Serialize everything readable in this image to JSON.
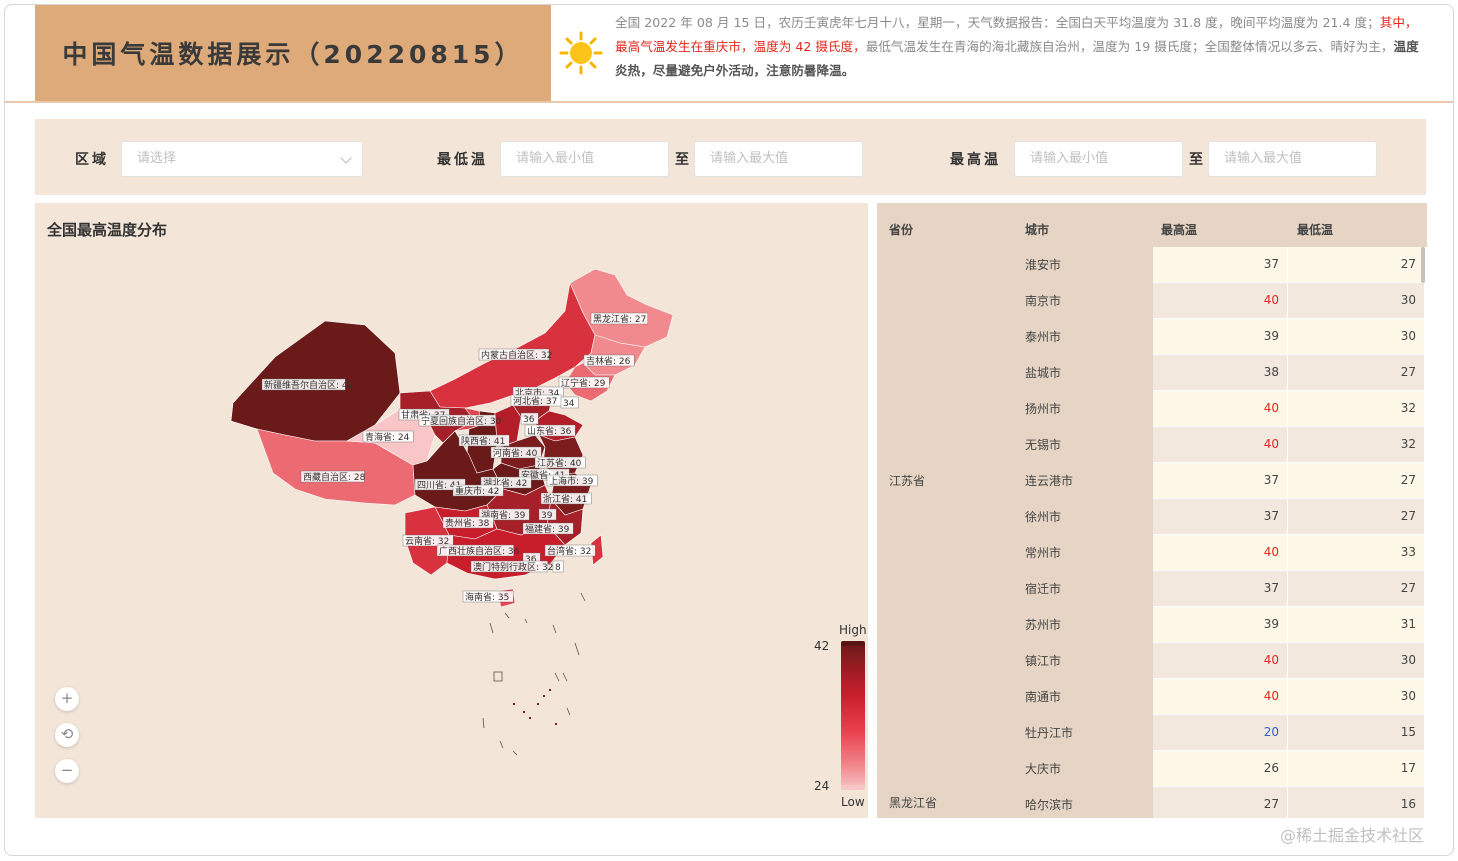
{
  "header": {
    "title": "中国气温数据展示（20220815）",
    "report_part1": "全国 2022 年 08 月 15 日，农历壬寅虎年七月十八，星期一，天气数据报告：全国白天平均温度为 31.8 度，晚间平均温度为 21.4 度；",
    "report_part2": "其中，最高气温发生在重庆市，温度为 42 摄氏度，",
    "report_part3": "最低气温发生在青海的海北藏族自治州，温度为 19 摄氏度；全国整体情况以多云、晴好为主，",
    "report_part4": "温度炎热，尽量避免户外活动，注意防暑降温。"
  },
  "filters": {
    "region_label": "区域",
    "region_placeholder": "请选择",
    "min_label": "最低温",
    "min_from_placeholder": "请输入最小值",
    "to_label": "至",
    "min_to_placeholder": "请输入最大值",
    "max_label": "最高温",
    "max_from_placeholder": "请输入最小值",
    "max_to_placeholder": "请输入最大值"
  },
  "map": {
    "title": "全国最高温度分布",
    "visual_map": {
      "high_label": "High",
      "low_label": "Low",
      "max": "42",
      "min": "24"
    },
    "zoom_in": "+",
    "zoom_reset": "⟲",
    "zoom_out": "−",
    "labels": [
      "黑龙江省: 27",
      "内蒙古自治区: 32",
      "吉林省: 26",
      "新疆维吾尔自治区: 41",
      "辽宁省: 29",
      "北京市: 34",
      "河北省: 37",
      "34",
      "甘肃省: 37",
      "宁夏回族自治区: 30",
      "36",
      "山东省: 36",
      "青海省: 24",
      "陕西省: 41",
      "河南省: 40",
      "江苏省: 40",
      "西藏自治区: 28",
      "安徽省: 41",
      "四川省: 41",
      "湖北省: 42",
      "重庆市: 42",
      "上海市: 39",
      "浙江省: 41",
      "湖南省: 39",
      "39",
      "贵州省: 38",
      "福建省: 39",
      "云南省: 32",
      "广西壮族自治区: 36",
      "36",
      "台湾省: 32",
      "澳门特别行政区: 32",
      "8",
      "海南省: 35"
    ]
  },
  "table": {
    "headers": [
      "省份",
      "城市",
      "最高温",
      "最低温"
    ],
    "province_groups": [
      {
        "name": "江苏省"
      },
      {
        "name": "黑龙江省"
      }
    ],
    "rows": [
      {
        "city": "淮安市",
        "max": "37",
        "min": "27",
        "flag": ""
      },
      {
        "city": "南京市",
        "max": "40",
        "min": "30",
        "flag": "hot"
      },
      {
        "city": "泰州市",
        "max": "39",
        "min": "30",
        "flag": ""
      },
      {
        "city": "盐城市",
        "max": "38",
        "min": "27",
        "flag": ""
      },
      {
        "city": "扬州市",
        "max": "40",
        "min": "32",
        "flag": "hot"
      },
      {
        "city": "无锡市",
        "max": "40",
        "min": "32",
        "flag": "hot"
      },
      {
        "city": "连云港市",
        "max": "37",
        "min": "27",
        "flag": ""
      },
      {
        "city": "徐州市",
        "max": "37",
        "min": "27",
        "flag": ""
      },
      {
        "city": "常州市",
        "max": "40",
        "min": "33",
        "flag": "hot"
      },
      {
        "city": "宿迁市",
        "max": "37",
        "min": "27",
        "flag": ""
      },
      {
        "city": "苏州市",
        "max": "39",
        "min": "31",
        "flag": ""
      },
      {
        "city": "镇江市",
        "max": "40",
        "min": "30",
        "flag": "hot"
      },
      {
        "city": "南通市",
        "max": "40",
        "min": "30",
        "flag": "hot"
      },
      {
        "city": "牡丹江市",
        "max": "20",
        "min": "15",
        "flag": "cold"
      },
      {
        "city": "大庆市",
        "max": "26",
        "min": "17",
        "flag": ""
      },
      {
        "city": "哈尔滨市",
        "max": "27",
        "min": "16",
        "flag": ""
      }
    ]
  },
  "colors": {
    "title_bg": "#deaa79",
    "panel_bg": "#f3e5d8",
    "accent_red": "#e0281e",
    "cold_blue": "#2f62c7"
  },
  "watermark": "@稀土掘金技术社区"
}
